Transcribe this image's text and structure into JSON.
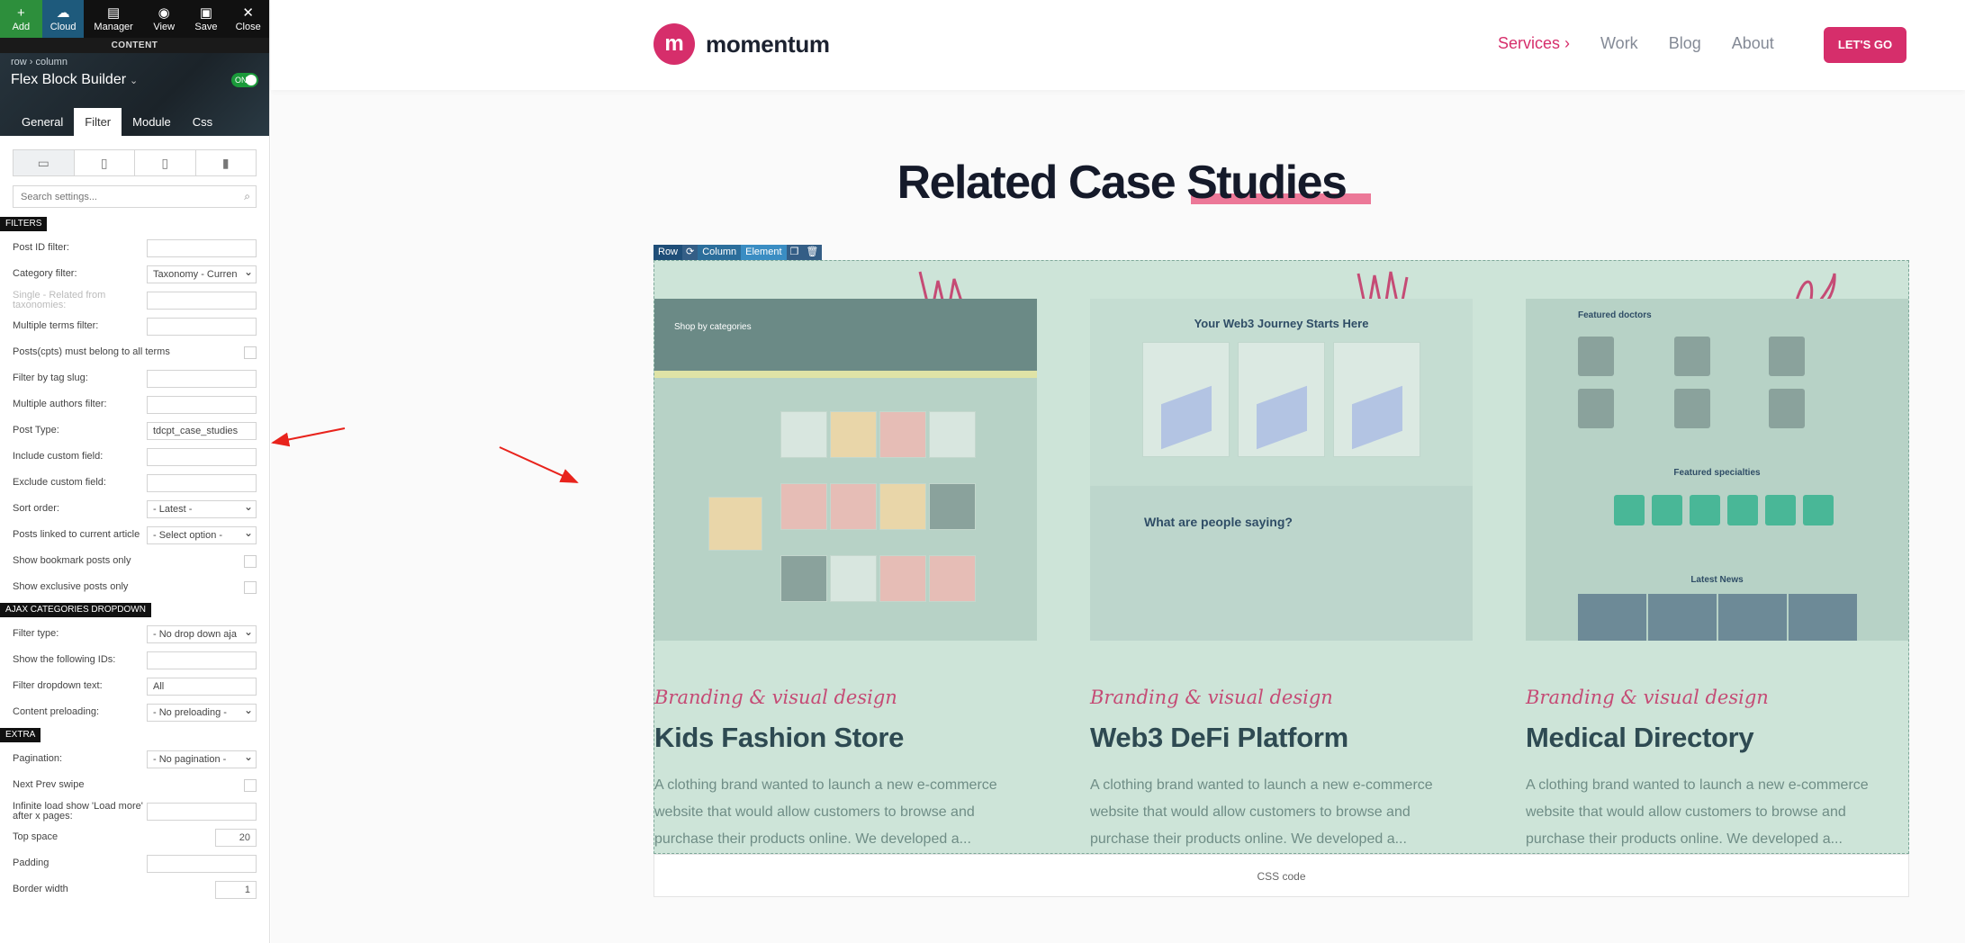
{
  "toolbar": {
    "add": "Add",
    "cloud": "Cloud",
    "manager": "Manager",
    "view": "View",
    "save": "Save",
    "close": "Close",
    "content_label": "CONTENT"
  },
  "builder": {
    "breadcrumb": "row › column",
    "title": "Flex Block Builder",
    "toggle": "ON",
    "tabs": [
      "General",
      "Filter",
      "Module",
      "Css"
    ],
    "active_tab": "Filter",
    "search_placeholder": "Search settings..."
  },
  "filters": {
    "section": "FILTERS",
    "rows": [
      {
        "label": "Post ID filter:",
        "value": "",
        "type": "input"
      },
      {
        "label": "Category filter:",
        "value": "Taxonomy - Curren",
        "type": "select"
      },
      {
        "label": "Single - Related from taxonomies:",
        "value": "",
        "type": "input",
        "dim": true
      },
      {
        "label": "Multiple terms filter:",
        "value": "",
        "type": "input"
      },
      {
        "label": "Posts(cpts) must belong to all terms",
        "value": "",
        "type": "checkbox"
      },
      {
        "label": "Filter by tag slug:",
        "value": "",
        "type": "input"
      },
      {
        "label": "Multiple authors filter:",
        "value": "",
        "type": "input"
      },
      {
        "label": "Post Type:",
        "value": "tdcpt_case_studies",
        "type": "input"
      },
      {
        "label": "Include custom field:",
        "value": "",
        "type": "input"
      },
      {
        "label": "Exclude custom field:",
        "value": "",
        "type": "input"
      },
      {
        "label": "Sort order:",
        "value": "- Latest -",
        "type": "select"
      },
      {
        "label": "Posts linked to current article",
        "value": "- Select option -",
        "type": "select"
      },
      {
        "label": "Show bookmark posts only",
        "value": "",
        "type": "checkbox"
      },
      {
        "label": "Show exclusive posts only",
        "value": "",
        "type": "checkbox"
      }
    ]
  },
  "ajax": {
    "section": "AJAX CATEGORIES DROPDOWN",
    "rows": [
      {
        "label": "Filter type:",
        "value": "- No drop down aja",
        "type": "select"
      },
      {
        "label": "Show the following IDs:",
        "value": "",
        "type": "input"
      },
      {
        "label": "Filter dropdown text:",
        "value": "All",
        "type": "input"
      },
      {
        "label": "Content preloading:",
        "value": "- No preloading -",
        "type": "select"
      }
    ]
  },
  "extra": {
    "section": "EXTRA",
    "rows": [
      {
        "label": "Pagination:",
        "value": "- No pagination -",
        "type": "select"
      },
      {
        "label": "Next Prev swipe",
        "value": "",
        "type": "checkbox"
      },
      {
        "label": "Infinite load show 'Load more' after x pages:",
        "value": "",
        "type": "input"
      },
      {
        "label": "Top space",
        "value": "20",
        "type": "number"
      },
      {
        "label": "Padding",
        "value": "",
        "type": "input"
      },
      {
        "label": "Border width",
        "value": "1",
        "type": "number"
      }
    ]
  },
  "site": {
    "logo_mark": "m",
    "logo_text": "momentum",
    "menu": [
      "Services ›",
      "Work",
      "Blog",
      "About"
    ],
    "cta": "LET'S GO",
    "heading": "Related Case Studies",
    "edit_toolbar": [
      "Row",
      "Column",
      "Element"
    ],
    "cards": [
      {
        "category": "Branding & visual design",
        "title": "Kids Fashion Store",
        "description": "A clothing brand wanted to launch a new e-commerce website that would allow customers to browse and purchase their products online. We developed a..."
      },
      {
        "category": "Branding & visual design",
        "title": "Web3 DeFi Platform",
        "description": "A clothing brand wanted to launch a new e-commerce website that would allow customers to browse and purchase their products online. We developed a..."
      },
      {
        "category": "Branding & visual design",
        "title": "Medical Directory",
        "description": "A clothing brand wanted to launch a new e-commerce website that would allow customers to browse and purchase their products online. We developed a..."
      }
    ],
    "thumb_texts": {
      "shop": "Shop by categories",
      "web3_heading": "Your Web3 Journey Starts Here",
      "web3_question": "What are people saying?",
      "doctors": "Featured doctors",
      "specialties": "Featured specialties",
      "news": "Latest News"
    },
    "css_code": "CSS code"
  },
  "colors": {
    "brand": "#d62e6b",
    "panel_dark": "#111111",
    "overlay": "#cde4d8"
  }
}
